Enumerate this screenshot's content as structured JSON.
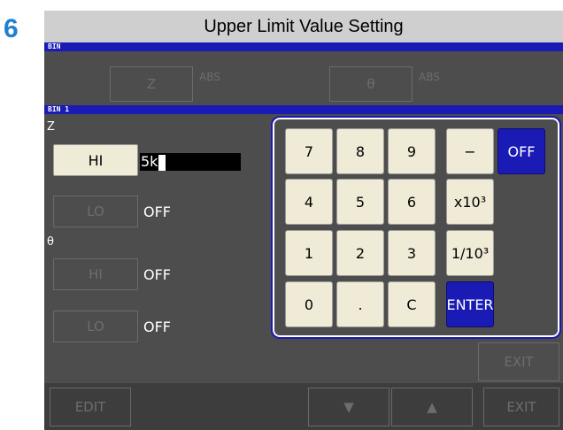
{
  "step_number": "6",
  "title": "Upper Limit Value Setting",
  "bin_header": "BIN",
  "bin1_header": "BIN 1",
  "top_params": [
    {
      "label": "Z",
      "mode": "ABS"
    },
    {
      "label": "θ",
      "mode": "ABS"
    }
  ],
  "z_section": {
    "label": "Z",
    "hi_button": "HI",
    "hi_value": "5k",
    "lo_button": "LO",
    "lo_value": "OFF"
  },
  "theta_section": {
    "label": "θ",
    "hi_button": "HI",
    "hi_value": "OFF",
    "lo_button": "LO",
    "lo_value": "OFF"
  },
  "keypad": {
    "keys": [
      "7",
      "8",
      "9",
      "−",
      "OFF",
      "4",
      "5",
      "6",
      "x10³",
      "1",
      "2",
      "3",
      "1/10³",
      "0",
      ".",
      "C",
      "ENTER"
    ]
  },
  "exit_upper": "EXIT",
  "bottom_bar": {
    "edit": "EDIT",
    "down_icon": "▼",
    "up_icon": "▲",
    "exit": "EXIT"
  },
  "colors": {
    "accent_blue": "#1a1ab5",
    "key_face": "#efebd6",
    "screen_bg": "#4d4d4d",
    "step_number": "#1f7fd0"
  }
}
